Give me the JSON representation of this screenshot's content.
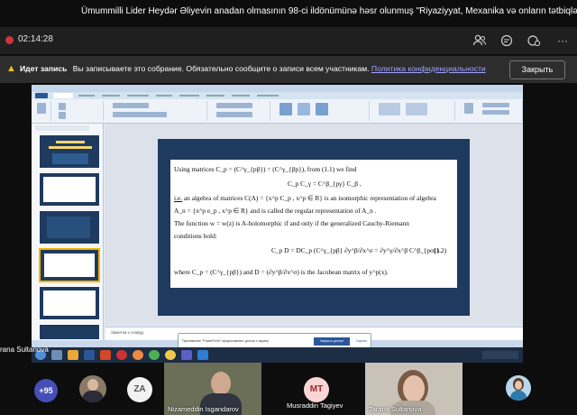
{
  "marquee": {
    "text": "Ümummilli Lider Heydər Əliyevin anadan olmasının 98-ci ildönümünə həsr olunmuş \"Riyaziyyat, Mexanika və onların tətbiqləri\" mövzusunda Re"
  },
  "meeting": {
    "timer": "02:14:28",
    "icons": [
      "people-icon",
      "chat-icon",
      "reactions-icon",
      "more-icon"
    ]
  },
  "banner": {
    "title": "Идет запись",
    "message": "Вы записываете это собрание. Обязательно сообщите о записи всем участникам.",
    "link": "Политика конфиденциальности",
    "close": "Закрыть"
  },
  "presenter": {
    "name": "rana Sultanova"
  },
  "slide": {
    "line1": "Using matrices C_p = (C^γ_{pβ}) = (C^γ_{βp}), from (1.1) we find",
    "formula1": "C_p C_γ = C^β_{pγ} C_β ,",
    "line2_i": "i.e.",
    "line2": " an algebra of matrices  C(A) = {x^p C_p , x^p ∈ R}  is an isomorphic representation of algebra",
    "line3": "A_n = {x^p e_p , x^p ∈ R}  and is called the regular representation of  A_n .",
    "line4": "The function  w = w(z)  is  A-holomorphic if and only if the generalized Cauchy-Riemann",
    "line5": "conditions hold:",
    "formula2": "C_p D = DC_p    (C^γ_{pβ} ∂y^β/∂x^σ = ∂y^γ/∂x^β C^β_{pσ}) ,",
    "eqnum": "(1.2)",
    "line6": "where  C_p = (C^γ_{pβ})  and  D = (∂y^β/∂x^σ)  is the Jacobean matrix of  y^p(x)."
  },
  "ppt": {
    "notes_placeholder": "Заметки к слайду",
    "notification": "Приложение \"PowerPoint\" предоставляет доступ к экрану",
    "notif_btn1": "Закрыть доступ",
    "notif_btn2": "Скрыть"
  },
  "participants": {
    "more": "+95",
    "za": "ZA",
    "mt": "MT",
    "nizameddin": "Nizameddin Isgandarov",
    "musraddin": "Musraddin Tagiyev",
    "tarana": "Tarana Sultanova"
  },
  "colors": {
    "za_bg": "#f2f2f2",
    "mt_bg": "#f9d6d5",
    "more_bg": "#464eb8"
  }
}
